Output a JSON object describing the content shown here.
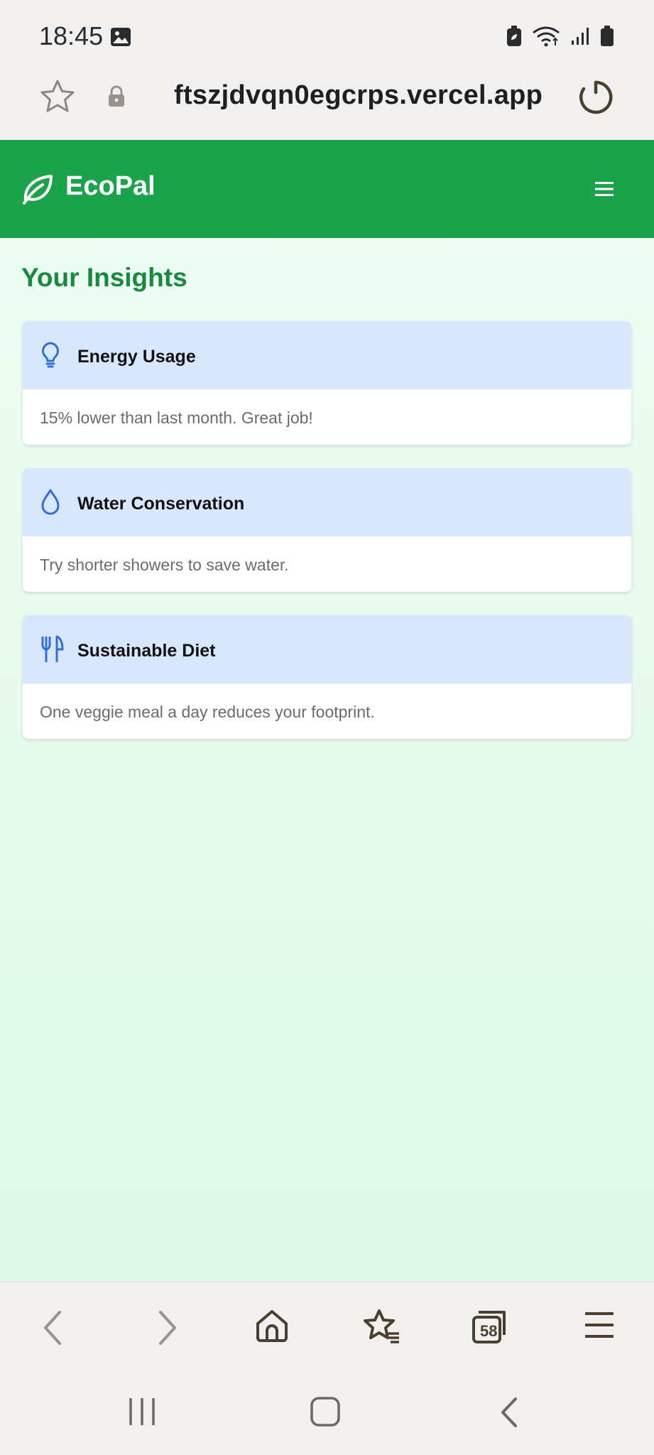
{
  "status_bar": {
    "time": "18:45",
    "icons": [
      "image-icon",
      "battery-saver-icon",
      "wifi-icon",
      "signal-icon",
      "battery-icon"
    ]
  },
  "browser": {
    "url": "ftszjdvqn0egcrps.vercel.app",
    "tabs_count": "58",
    "toolbar": [
      "back-icon",
      "forward-icon",
      "home-icon",
      "bookmarks-icon",
      "tabs-icon",
      "menu-icon"
    ]
  },
  "app": {
    "brand": "EcoPal",
    "accent_color": "#1aa34a",
    "page_title": "Your Insights",
    "cards": [
      {
        "icon": "lightbulb-icon",
        "title": "Energy Usage",
        "text": "15% lower than last month. Great job!"
      },
      {
        "icon": "water-drop-icon",
        "title": "Water Conservation",
        "text": "Try shorter showers to save water."
      },
      {
        "icon": "utensils-icon",
        "title": "Sustainable Diet",
        "text": "One veggie meal a day reduces your footprint."
      }
    ]
  },
  "system_nav": [
    "recent-apps-icon",
    "home-button-icon",
    "back-button-icon"
  ]
}
